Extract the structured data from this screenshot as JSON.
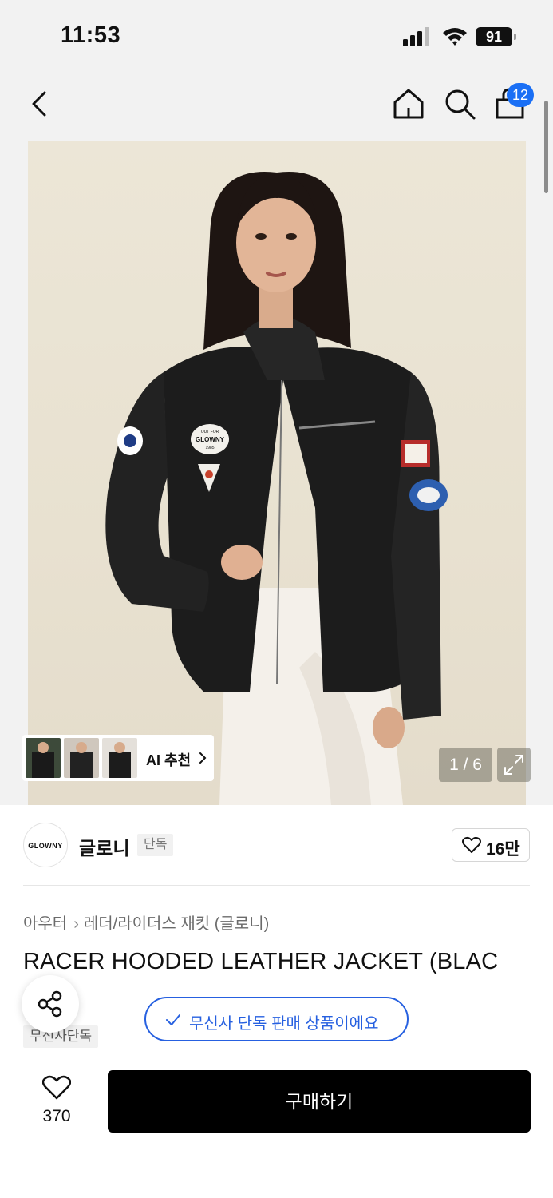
{
  "status_bar": {
    "time": "11:53",
    "battery": "91"
  },
  "nav": {
    "cart_count": "12"
  },
  "gallery": {
    "ai_recommend_label": "AI 추천",
    "counter": "1 / 6"
  },
  "brand": {
    "logo_text": "GLOWNY",
    "name": "글로니",
    "tag": "단독",
    "like_count": "16만"
  },
  "breadcrumb": [
    "아우터",
    "레더/라이더스 재킷 (글로니)"
  ],
  "product": {
    "title": "RACER HOODED LEATHER JACKET (BLAC",
    "exclusive_tag": "무신사단독",
    "notice": "무신사 단독 판매 상품이에요"
  },
  "bottom": {
    "wish_count": "370",
    "buy_label": "구매하기"
  },
  "patches": {
    "chest": "GLOWNY",
    "chest_top": "OUT FOR",
    "chest_bottom": "1985"
  }
}
